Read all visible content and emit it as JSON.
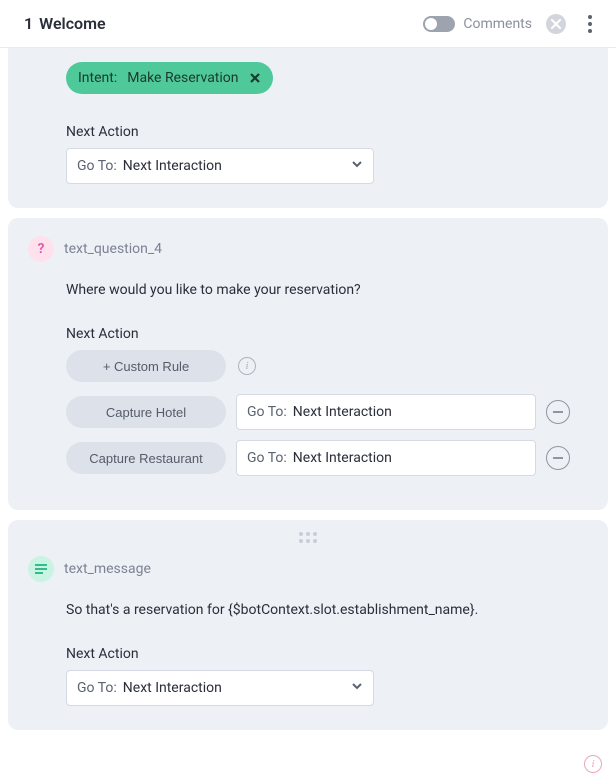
{
  "header": {
    "index": "1",
    "title": "Welcome",
    "comments_label": "Comments",
    "comments_on": false
  },
  "labels": {
    "next_action": "Next Action",
    "goto_prefix": "Go To:",
    "custom_rule": "+ Custom Rule"
  },
  "card1": {
    "intent": {
      "label": "Intent:",
      "value": "Make Reservation"
    },
    "next_action_value": "Next Interaction"
  },
  "card2": {
    "node_name": "text_question_4",
    "question_text": "Where would you like to make your reservation?",
    "rules": [
      {
        "capture_label": "Capture Hotel",
        "goto_value": "Next Interaction"
      },
      {
        "capture_label": "Capture Restaurant",
        "goto_value": "Next Interaction"
      }
    ]
  },
  "card3": {
    "node_name": "text_message",
    "message_text": "So that's a reservation for {$botContext.slot.establishment_name}.",
    "next_action_value": "Next Interaction"
  },
  "icons": {
    "question": "?",
    "info": "i"
  }
}
